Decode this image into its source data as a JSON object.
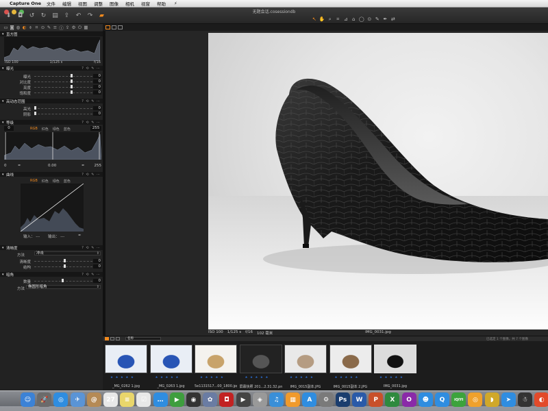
{
  "menubar": {
    "apple": "",
    "app": "Capture One",
    "items": [
      "文件",
      "编辑",
      "视图",
      "调整",
      "图像",
      "相机",
      "视窗",
      "帮助"
    ],
    "bolt": "⚡"
  },
  "window": {
    "title": "无题会话.cosessiondb"
  },
  "toolbar_icons_left": [
    "import-icon",
    "capture-icon",
    "rotate-left-icon",
    "rotate-right-icon",
    "import-folder-icon",
    "export-icon",
    "undo-icon",
    "redo-icon",
    "recipe-icon"
  ],
  "toolbar_icons_right": [
    "cursor-icon",
    "pan-icon",
    "loupe-icon",
    "crop-icon",
    "straighten-icon",
    "keystone-icon",
    "mask-icon",
    "spot-icon",
    "picker-icon",
    "wb-picker-icon",
    "copy-icon"
  ],
  "left_panel": {
    "histogram": {
      "title": "直方图",
      "iso": "ISO 100",
      "shutter": "1/125 s",
      "fstop": "f/16"
    },
    "exposure": {
      "title": "曝光",
      "sliders": [
        {
          "label": "曝光",
          "value": "0",
          "pos": 0.62
        },
        {
          "label": "对比度",
          "value": "0",
          "pos": 0.62
        },
        {
          "label": "亮度",
          "value": "0",
          "pos": 0.62
        },
        {
          "label": "饱和度",
          "value": "0",
          "pos": 0.62
        }
      ]
    },
    "hdr": {
      "title": "高动态范围",
      "sliders": [
        {
          "label": "高光",
          "value": "0",
          "pos": 0.0
        },
        {
          "label": "阴影",
          "value": "0",
          "pos": 0.0
        }
      ]
    },
    "levels": {
      "title": "等级",
      "left_val": "0",
      "right_val": "255",
      "tabs": [
        "RGB",
        "红色",
        "绿色",
        "蓝色"
      ],
      "black": "0",
      "mid": "0.00",
      "white": "255"
    },
    "curve": {
      "title": "曲线",
      "tabs": [
        "RGB",
        "红色",
        "绿色",
        "蓝色"
      ],
      "input_label": "输入：",
      "input_val": "---",
      "output_label": "输出：",
      "output_val": "---"
    },
    "clarity": {
      "title": "清晰度",
      "method_label": "方法",
      "method_value": "冲击",
      "sliders": [
        {
          "label": "清晰度",
          "value": "0",
          "pos": 0.5
        },
        {
          "label": "结构",
          "value": "0",
          "pos": 0.5
        }
      ]
    },
    "vignette": {
      "title": "暗角",
      "amount_label": "数量",
      "amount_value": "0",
      "method_label": "方法",
      "method_value": "椭圆形暗角"
    }
  },
  "photo": {
    "iso": "ISO 100",
    "shutter": "1/125 s",
    "fstop": "f/16",
    "focal": "102 毫米",
    "filename": "IMG_0031.jpg"
  },
  "browser": {
    "sort": "名称",
    "count": "已选定 1 个图像，共 7 个图像",
    "thumbs": [
      {
        "caption": "_MG_0262 1.jpg",
        "kind": "blue"
      },
      {
        "caption": "_MG_0263 1.jpg",
        "kind": "blue"
      },
      {
        "caption": "5e1131517...00_1800.jpg",
        "kind": "gold"
      },
      {
        "caption": "屏幕快照 201...2.31.32.png",
        "kind": "screen"
      },
      {
        "caption": "IMG_0015副本.JPG",
        "kind": "beige"
      },
      {
        "caption": "IMG_0015副本 2.JPG",
        "kind": "tan"
      },
      {
        "caption": "IMG_0031.jpg",
        "kind": "black"
      }
    ],
    "stars": "★ ★ ★ ★ ★"
  },
  "dock": {
    "icons": [
      {
        "name": "finder-icon",
        "glyph": "☺",
        "color": "#3c82d6"
      },
      {
        "name": "launchpad-icon",
        "glyph": "🚀",
        "color": "#6b6b6b"
      },
      {
        "name": "safari-icon",
        "glyph": "◎",
        "color": "#2f8de0"
      },
      {
        "name": "mail-icon",
        "glyph": "✈",
        "color": "#5a94d6"
      },
      {
        "name": "contacts-icon",
        "glyph": "@",
        "color": "#b58a55"
      },
      {
        "name": "calendar-icon",
        "glyph": "27",
        "color": "#e8e8e8"
      },
      {
        "name": "notes-icon",
        "glyph": "≡",
        "color": "#e9d66b"
      },
      {
        "name": "reminders-icon",
        "glyph": "☑",
        "color": "#e8e8e8"
      },
      {
        "name": "messages-icon",
        "glyph": "…",
        "color": "#2f8de0"
      },
      {
        "name": "facetime-icon",
        "glyph": "▶",
        "color": "#3e9e3e"
      },
      {
        "name": "photobooth-icon",
        "glyph": "◉",
        "color": "#333"
      },
      {
        "name": "photos-icon",
        "glyph": "✿",
        "color": "#6a7ca3"
      },
      {
        "name": "captureone-icon",
        "glyph": "◘",
        "color": "#c22222"
      },
      {
        "name": "videoplayer-icon",
        "glyph": "▶",
        "color": "#444"
      },
      {
        "name": "preview-icon",
        "glyph": "◈",
        "color": "#999"
      },
      {
        "name": "itunes-icon",
        "glyph": "♫",
        "color": "#3a8fd8"
      },
      {
        "name": "ibooks-icon",
        "glyph": "▦",
        "color": "#f09a2c"
      },
      {
        "name": "appstore-icon",
        "glyph": "A",
        "color": "#2f8de0"
      },
      {
        "name": "systemprefs-icon",
        "glyph": "⚙",
        "color": "#7a7a7a"
      },
      {
        "name": "photoshop-icon",
        "glyph": "Ps",
        "color": "#1a3d6e"
      },
      {
        "name": "word-icon",
        "glyph": "W",
        "color": "#2a5aa8"
      },
      {
        "name": "powerpoint-icon",
        "glyph": "P",
        "color": "#c8502a"
      },
      {
        "name": "excel-icon",
        "glyph": "X",
        "color": "#2e8a3e"
      },
      {
        "name": "onenote-icon",
        "glyph": "O",
        "color": "#8a2aa8"
      },
      {
        "name": "finder-face-icon",
        "glyph": "☻",
        "color": "#2f8de0"
      },
      {
        "name": "qq-icon",
        "glyph": "Q",
        "color": "#2f8de0"
      },
      {
        "name": "iqiyi-icon",
        "glyph": "iQIYI",
        "color": "#3ca33c"
      },
      {
        "name": "player-icon",
        "glyph": "◎",
        "color": "#f0a12c"
      },
      {
        "name": "bird-icon",
        "glyph": "◗",
        "color": "#d0a82a"
      },
      {
        "name": "send-icon",
        "glyph": "➤",
        "color": "#2f8de0"
      },
      {
        "name": "penguin-icon",
        "glyph": "☃",
        "color": "#333"
      },
      {
        "name": "browser-icon",
        "glyph": "◐",
        "color": "#e24a2a"
      }
    ]
  }
}
